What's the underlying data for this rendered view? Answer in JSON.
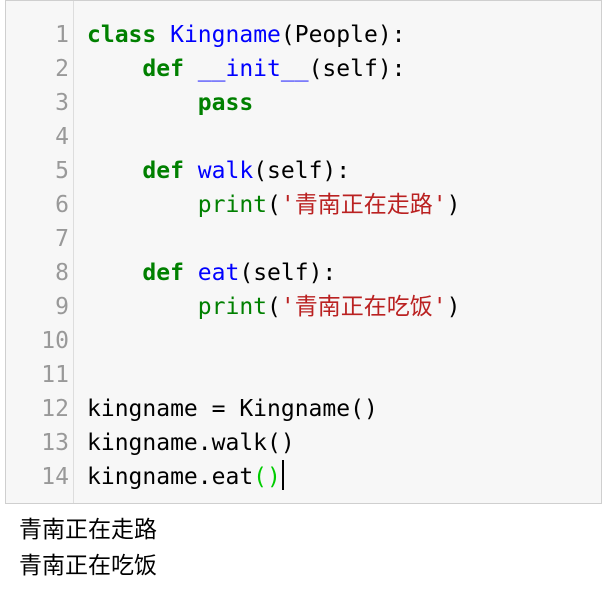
{
  "editor": {
    "line_numbers": [
      "1",
      "2",
      "3",
      "4",
      "5",
      "6",
      "7",
      "8",
      "9",
      "10",
      "11",
      "12",
      "13",
      "14"
    ],
    "lines": [
      {
        "kw": "class",
        "sp": " ",
        "name": "Kingname",
        "rest": "(People):"
      },
      {
        "indent": "    ",
        "kw": "def",
        "sp": " ",
        "name": "__init__",
        "rest": "(self):"
      },
      {
        "indent": "        ",
        "kw": "pass"
      },
      {},
      {
        "indent": "    ",
        "kw": "def",
        "sp": " ",
        "name": "walk",
        "rest": "(self):"
      },
      {
        "indent": "        ",
        "builtin": "print",
        "open": "(",
        "string": "'青南正在走路'",
        "close": ")"
      },
      {},
      {
        "indent": "    ",
        "kw": "def",
        "sp": " ",
        "name": "eat",
        "rest": "(self):"
      },
      {
        "indent": "        ",
        "builtin": "print",
        "open": "(",
        "string": "'青南正在吃饭'",
        "close": ")"
      },
      {},
      {},
      {
        "text": "kingname = Kingname()"
      },
      {
        "text": "kingname.walk()"
      },
      {
        "text": "kingname.eat",
        "match": "()"
      }
    ]
  },
  "output": {
    "lines": [
      "青南正在走路",
      "青南正在吃饭"
    ]
  },
  "colors": {
    "keyword": "#008000",
    "name": "#0000ff",
    "string": "#ba2121",
    "matching_bracket": "#00cc00",
    "gutter_text": "#999999",
    "cell_background": "#f7f7f7"
  }
}
